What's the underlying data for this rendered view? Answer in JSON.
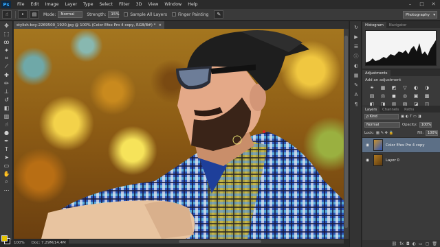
{
  "menu": {
    "logo": "Ps",
    "items": [
      "File",
      "Edit",
      "Image",
      "Layer",
      "Type",
      "Select",
      "Filter",
      "3D",
      "View",
      "Window",
      "Help"
    ],
    "window_controls": [
      "–",
      "□",
      "✕"
    ]
  },
  "options": {
    "mode_label": "Mode:",
    "mode_value": "Normal",
    "strength_label": "Strength:",
    "strength_value": "15%",
    "sample_all_layers": "Sample All Layers",
    "finger_painting": "Finger Painting",
    "workspace": "Photography"
  },
  "document": {
    "tab_title": "stylish-boy-2269500_1920.jpg @ 100% (Color Efex Pro 4 copy, RGB/8#) *",
    "close": "×"
  },
  "status": {
    "zoom": "100%",
    "doc_size": "Doc: 7.29M/14.4M"
  },
  "panels": {
    "top_tabs": [
      "Histogram",
      "Navigator"
    ],
    "adjustments_tab": "Adjustments",
    "adjustments_title": "Add an adjustment",
    "adjust_icons_row1": [
      "☀",
      "▦",
      "◩",
      "▽",
      "◐",
      "◑"
    ],
    "adjust_icons_row2": [
      "▤",
      "⚖",
      "◼",
      "◎",
      "▣",
      "▩"
    ],
    "adjust_icons_row3": [
      "◧",
      "◨",
      "▥",
      "▧",
      "◪",
      "◫"
    ],
    "layers_tabs": [
      "Layers",
      "Channels",
      "Paths"
    ],
    "kind_label": "ρ Kind",
    "blend_mode": "Normal",
    "opacity_label": "Opacity:",
    "opacity_value": "100%",
    "lock_label": "Lock:",
    "fill_label": "Fill:",
    "fill_value": "100%",
    "layers": [
      {
        "name": "Color Efex Pro 4 copy",
        "selected": true
      },
      {
        "name": "Layer 0",
        "selected": false
      }
    ]
  },
  "colors": {
    "foreground": "#e6c400",
    "background": "#111111",
    "selected_layer": "#5c6f86"
  }
}
